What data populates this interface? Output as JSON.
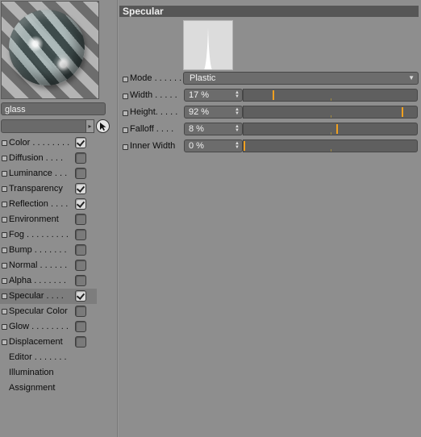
{
  "material": {
    "name": "glass",
    "path_value": ""
  },
  "channels": [
    {
      "label": "Color . . . . . . . .",
      "checkbox": true,
      "checked": true,
      "active": false
    },
    {
      "label": "Diffusion . . . .",
      "checkbox": true,
      "checked": false,
      "active": false
    },
    {
      "label": "Luminance . . .",
      "checkbox": true,
      "checked": false,
      "active": false
    },
    {
      "label": "Transparency",
      "checkbox": true,
      "checked": true,
      "active": false
    },
    {
      "label": "Reflection . . . .",
      "checkbox": true,
      "checked": true,
      "active": false
    },
    {
      "label": "Environment",
      "checkbox": true,
      "checked": false,
      "active": false
    },
    {
      "label": "Fog . . . . . . . . .",
      "checkbox": true,
      "checked": false,
      "active": false
    },
    {
      "label": "Bump . . . . . . .",
      "checkbox": true,
      "checked": false,
      "active": false
    },
    {
      "label": "Normal . . . . . .",
      "checkbox": true,
      "checked": false,
      "active": false
    },
    {
      "label": "Alpha . . . . . . .",
      "checkbox": true,
      "checked": false,
      "active": false
    },
    {
      "label": "Specular . . . .",
      "checkbox": true,
      "checked": true,
      "active": true
    },
    {
      "label": "Specular Color",
      "checkbox": true,
      "checked": false,
      "active": false
    },
    {
      "label": "Glow . . . . . . . .",
      "checkbox": true,
      "checked": false,
      "active": false
    },
    {
      "label": "Displacement",
      "checkbox": true,
      "checked": false,
      "active": false
    }
  ],
  "extra_tabs": [
    "Editor . . . . . . .",
    "Illumination",
    "Assignment"
  ],
  "panel": {
    "title": "Specular",
    "mode_label": "Mode . . . . . .",
    "mode_value": "Plastic",
    "params": [
      {
        "label": "Width . . . . .",
        "value": "17 %",
        "fraction": 0.17
      },
      {
        "label": "Height. . . . .",
        "value": "92 %",
        "fraction": 0.92
      },
      {
        "label": "Falloff . . . .",
        "value": "8 %",
        "fraction": 0.54
      },
      {
        "label": "Inner Width",
        "value": "0 %",
        "fraction": 0.0
      }
    ]
  },
  "colors": {
    "background": "#8e8e8e",
    "header": "#565656",
    "slider_handle": "#f0a020"
  }
}
